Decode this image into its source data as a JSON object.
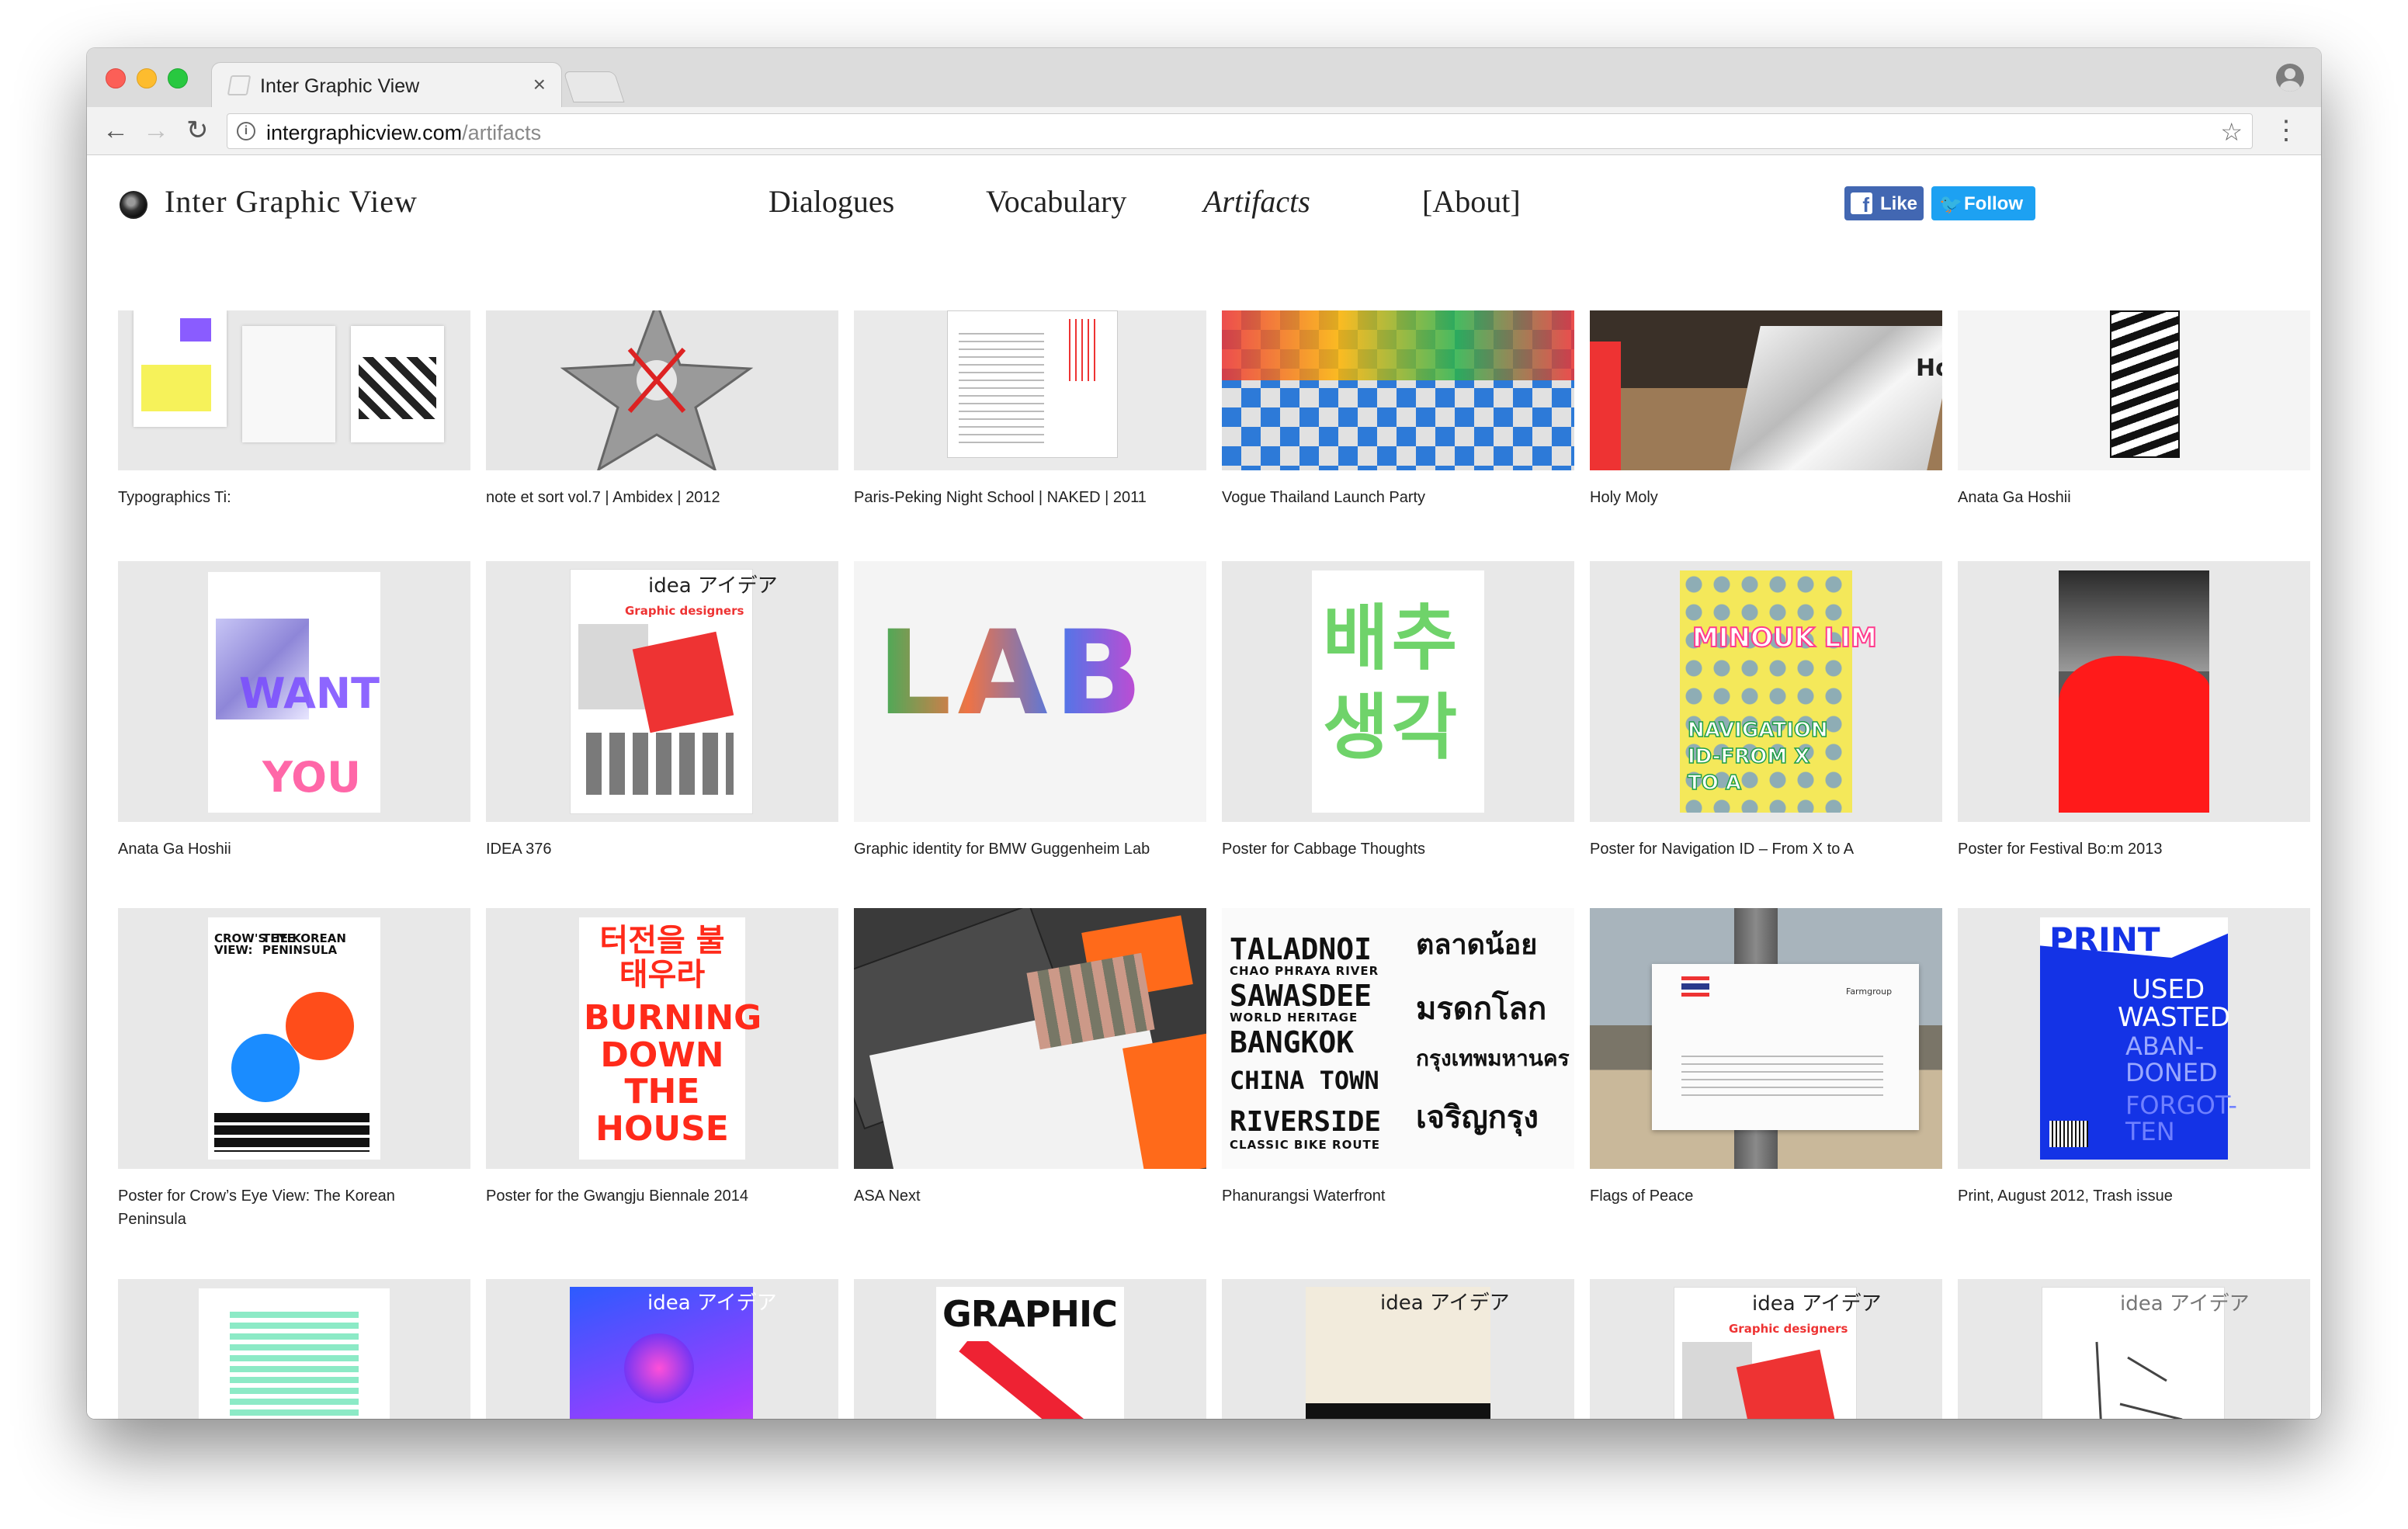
{
  "browser": {
    "tab_title": "Inter Graphic View",
    "tab_close": "×",
    "url_host": "intergraphicview.com",
    "url_path": "/artifacts"
  },
  "site": {
    "title": "Inter Graphic View",
    "nav": {
      "dialogues": "Dialogues",
      "vocabulary": "Vocabulary",
      "artifacts": "Artifacts",
      "about": "[About]"
    },
    "social": {
      "fb_icon": "f",
      "fb_label": "Like",
      "tw_icon": "🐦",
      "tw_label": "Follow"
    }
  },
  "artifacts": [
    {
      "caption": "Typographics Ti:"
    },
    {
      "caption": "note et sort vol.7 | Ambidex | 2012"
    },
    {
      "caption": "Paris-Peking Night School | NAKED | 2011"
    },
    {
      "caption": "Vogue Thailand Launch Party"
    },
    {
      "caption": "Holy Moly"
    },
    {
      "caption": "Anata Ga Hoshii"
    },
    {
      "caption": "Anata Ga Hoshii"
    },
    {
      "caption": "IDEA 376"
    },
    {
      "caption": "Graphic identity for BMW Guggenheim Lab"
    },
    {
      "caption": "Poster for Cabbage Thoughts"
    },
    {
      "caption": "Poster for Navigation ID – From X to A"
    },
    {
      "caption": "Poster for Festival Bo:m 2013"
    },
    {
      "caption": "Poster for Crow’s Eye View: The Korean Peninsula"
    },
    {
      "caption": "Poster for the Gwangju Biennale 2014"
    },
    {
      "caption": "ASA Next"
    },
    {
      "caption": "Phanurangsi Waterfront"
    },
    {
      "caption": "Flags of Peace"
    },
    {
      "caption": "Print, August 2012, Trash issue"
    },
    {
      "caption": ""
    },
    {
      "caption": ""
    },
    {
      "caption": ""
    },
    {
      "caption": ""
    },
    {
      "caption": ""
    },
    {
      "caption": ""
    }
  ],
  "poster_text": {
    "idea": "idea アイデア",
    "graphic_designers": "Graphic designers",
    "want": "WANT",
    "you": "YOU",
    "cabbage": "배추생각",
    "minouk": "MINOUK LIM",
    "navigation": "NAVIGATION ID-FROM X TO A",
    "crows_eye": "CROW'S EYE VIEW:",
    "korean_peninsula": "THE KOREAN PENINSULA",
    "gwangju_kr": "터전을 불태우라",
    "burning": "BURNING DOWN THE HOUSE",
    "taladnoi": "TALADNOI",
    "sawasdee": "SAWASDEE",
    "bangkok": "BANGKOK",
    "china_town": "CHINA TOWN",
    "riverside": "RIVERSIDE",
    "chao_phraya": "CHAO PHRAYA RIVER",
    "world_heritage": "WORLD HERITAGE",
    "classic_bike": "CLASSIC BIKE ROUTE",
    "thai_1": "ตลาดน้อย",
    "thai_2": "มรดกโลก",
    "thai_3": "กรุงเทพมหานคร",
    "thai_4": "เจริญกรุง",
    "print": "PRINT",
    "used": "USED",
    "wasted": "WASTED",
    "abandoned": "ABAN-DONED",
    "forgotten": "FORGOT-TEN",
    "graphic": "GRAPHIC",
    "farmgroup": "Farmgroup",
    "holy_moly": "Ho",
    "lab_words": "LAB"
  },
  "colors": {
    "fb_blue": "#4267b2",
    "tw_blue": "#1da1f2",
    "thumb_bg": "#e8e8e8",
    "red": "#ff1a1a",
    "print_blue": "#1433e6"
  }
}
